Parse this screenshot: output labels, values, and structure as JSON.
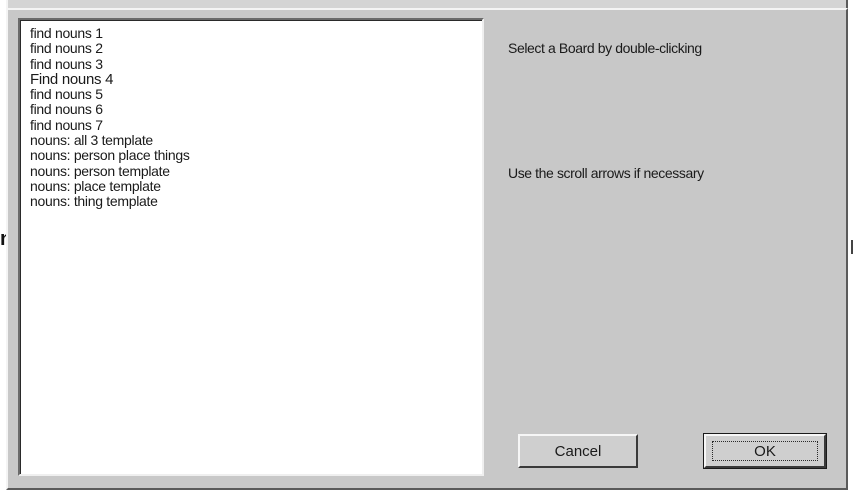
{
  "boards": {
    "items": [
      "find nouns 1",
      "find nouns 2",
      "find nouns 3",
      "Find nouns 4",
      "find nouns 5",
      "find nouns 6",
      "find nouns 7",
      "nouns: all 3 template",
      "nouns: person place things",
      "nouns: person template",
      "nouns: place template",
      "nouns: thing template"
    ]
  },
  "instructions": {
    "line1": "Select a Board by double-clicking",
    "line2": "Use the scroll arrows if necessary"
  },
  "buttons": {
    "cancel": "Cancel",
    "ok": "OK"
  },
  "background": {
    "edge_letter": "n"
  }
}
